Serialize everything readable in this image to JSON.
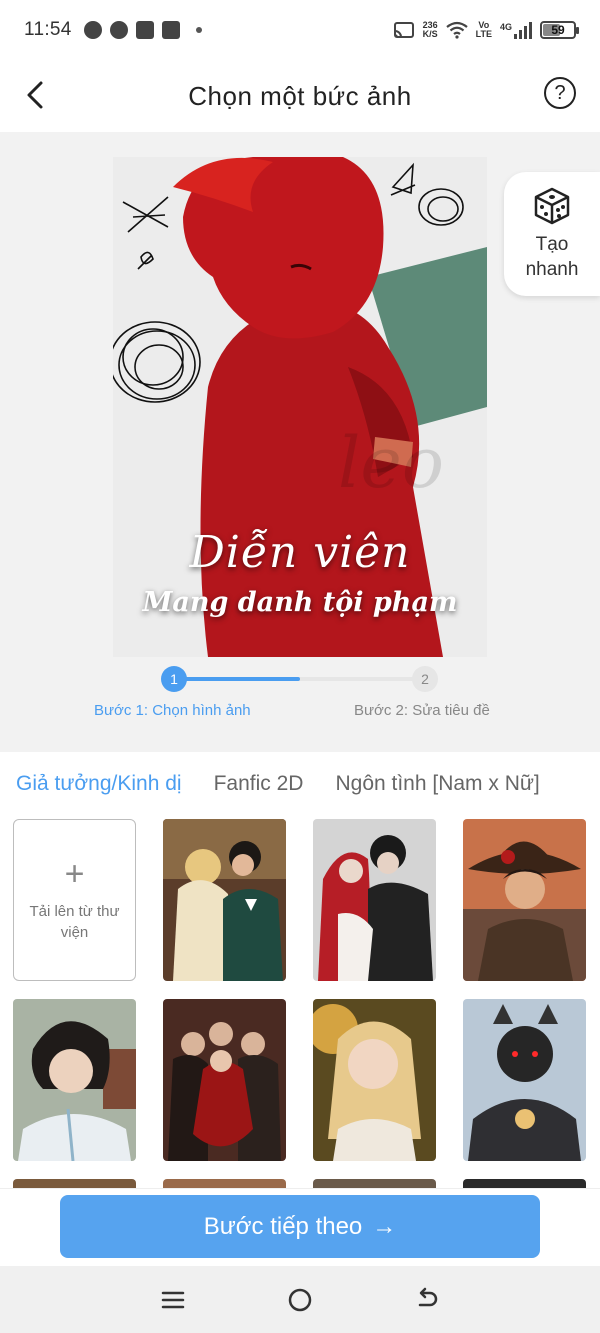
{
  "status_bar": {
    "time": "11:54",
    "net_speed_value": "236",
    "net_speed_unit": "K/S",
    "volte_top": "Vo",
    "volte_bottom": "LTE",
    "network": "4G",
    "battery": "59",
    "battery_level": 0.59
  },
  "header": {
    "title": "Chọn một bức ảnh",
    "help_label": "?"
  },
  "preview": {
    "cover_title_line1": "Diễn viên",
    "cover_title_line2": "Mang danh tội phạm",
    "cover_watermark": "leo"
  },
  "quick_create": {
    "label_line1": "Tạo",
    "label_line2": "nhanh"
  },
  "stepper": {
    "step1_number": "1",
    "step1_label": "Bước 1: Chọn hình ảnh",
    "step2_number": "2",
    "step2_label": "Bước 2: Sửa tiêu đề",
    "progress": 0.5
  },
  "tabs": [
    {
      "label": "Giả tưởng/Kinh dị",
      "active": true
    },
    {
      "label": "Fanfic 2D",
      "active": false
    },
    {
      "label": "Ngôn tình [Nam x Nữ]",
      "active": false
    }
  ],
  "gallery": {
    "upload_plus": "+",
    "upload_label": "Tải lên từ thư viện"
  },
  "bottom": {
    "next_label": "Bước tiếp theo",
    "next_arrow": "→"
  },
  "colors": {
    "accent": "#4a9df0",
    "button": "#56a3ef"
  }
}
